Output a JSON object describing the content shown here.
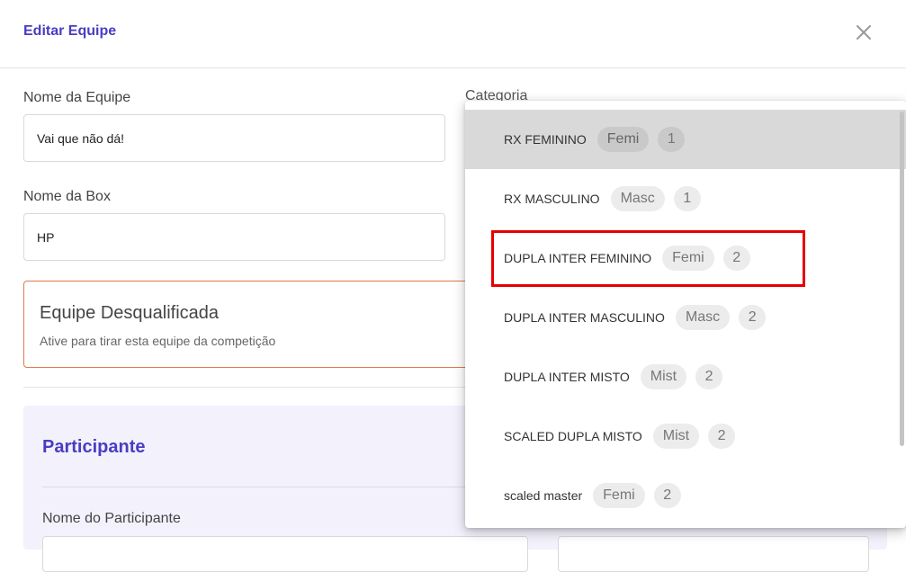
{
  "header": {
    "title": "Editar Equipe",
    "close_icon": "close-icon"
  },
  "form": {
    "team_name_label": "Nome da Equipe",
    "team_name_value": "Vai que não dá!",
    "box_name_label": "Nome da Box",
    "box_name_value": "HP",
    "category_label": "Categoria"
  },
  "disqualified": {
    "title": "Equipe Desqualificada",
    "subtitle": "Ative para tirar esta equipe da competição"
  },
  "participant": {
    "title": "Participante",
    "name_label": "Nome do Participante"
  },
  "dropdown": {
    "items": [
      {
        "name": "RX FEMININO",
        "gender": "Femi",
        "count": "1",
        "selected": true
      },
      {
        "name": "RX MASCULINO",
        "gender": "Masc",
        "count": "1",
        "selected": false
      },
      {
        "name": "DUPLA INTER FEMININO",
        "gender": "Femi",
        "count": "2",
        "selected": false
      },
      {
        "name": "DUPLA INTER MASCULINO",
        "gender": "Masc",
        "count": "2",
        "selected": false
      },
      {
        "name": "DUPLA INTER MISTO",
        "gender": "Mist",
        "count": "2",
        "selected": false
      },
      {
        "name": "SCALED DUPLA MISTO",
        "gender": "Mist",
        "count": "2",
        "selected": false
      },
      {
        "name": "scaled master",
        "gender": "Femi",
        "count": "2",
        "selected": false
      }
    ]
  },
  "colors": {
    "accent": "#4a3cc2",
    "highlight": "#e60000",
    "warning_border": "#e0784a",
    "panel_bg": "#f3f1fc"
  }
}
